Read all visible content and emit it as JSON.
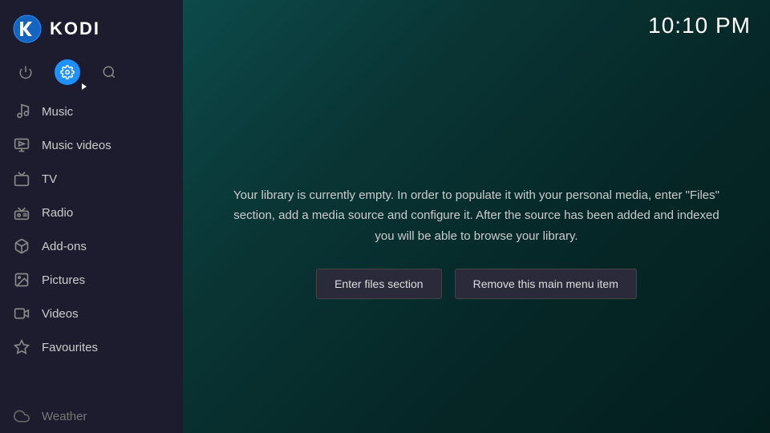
{
  "app": {
    "name": "KODI"
  },
  "clock": "10:10 PM",
  "sidebar": {
    "icons": [
      {
        "name": "power-icon",
        "label": "Power",
        "active": false
      },
      {
        "name": "settings-icon",
        "label": "Settings",
        "active": true
      },
      {
        "name": "search-icon",
        "label": "Search",
        "active": false
      }
    ],
    "menu_items": [
      {
        "id": "music",
        "label": "Music",
        "icon": "music"
      },
      {
        "id": "music-videos",
        "label": "Music videos",
        "icon": "music-video"
      },
      {
        "id": "tv",
        "label": "TV",
        "icon": "tv"
      },
      {
        "id": "radio",
        "label": "Radio",
        "icon": "radio"
      },
      {
        "id": "add-ons",
        "label": "Add-ons",
        "icon": "addons"
      },
      {
        "id": "pictures",
        "label": "Pictures",
        "icon": "pictures"
      },
      {
        "id": "videos",
        "label": "Videos",
        "icon": "videos"
      },
      {
        "id": "favourites",
        "label": "Favourites",
        "icon": "star"
      }
    ],
    "bottom_item": {
      "id": "weather",
      "label": "Weather",
      "icon": "weather"
    }
  },
  "main": {
    "info_text": "Your library is currently empty. In order to populate it with your personal media, enter \"Files\" section, add a media source and configure it. After the source has been added and indexed you will be able to browse your library.",
    "buttons": {
      "enter_files": "Enter files section",
      "remove_menu": "Remove this main menu item"
    }
  }
}
